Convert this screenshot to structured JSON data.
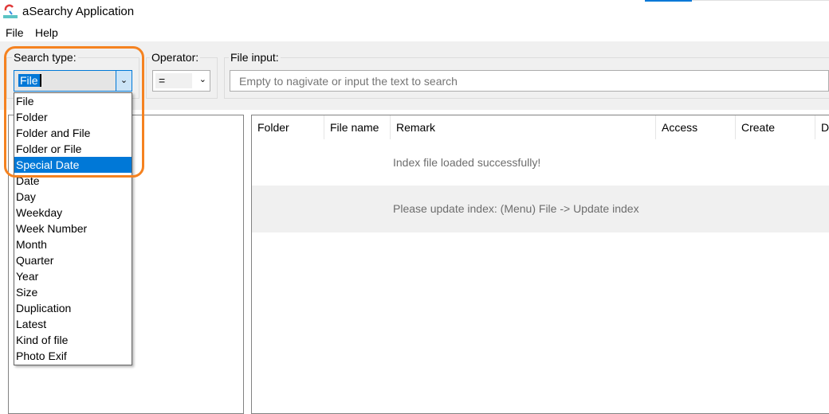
{
  "window": {
    "title": "aSearchy Application"
  },
  "menu": [
    "File",
    "Help"
  ],
  "search_type": {
    "label": "Search type:",
    "value": "File",
    "options": [
      "File",
      "Folder",
      "Folder and File",
      "Folder or File",
      "Special Date",
      "Date",
      "Day",
      "Weekday",
      "Week Number",
      "Month",
      "Quarter",
      "Year",
      "Size",
      "Duplication",
      "Latest",
      "Kind of file",
      "Photo Exif"
    ],
    "selected_option": "Special Date"
  },
  "operator": {
    "label": "Operator:",
    "value": "="
  },
  "file_input": {
    "label": "File input:",
    "placeholder": "Empty to nagivate or input the text to search"
  },
  "table": {
    "columns": [
      "Folder",
      "File name",
      "Remark",
      "Access",
      "Create",
      "D"
    ],
    "rows": [
      "Index file loaded successfully!",
      "Please update index: (Menu) File -> Update index"
    ]
  },
  "colors": {
    "accent": "#0078d7",
    "highlight": "#f58220"
  }
}
